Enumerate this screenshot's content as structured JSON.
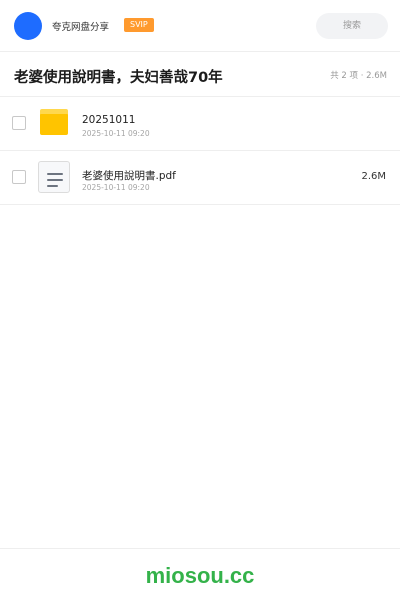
{
  "header": {
    "owner_name": "夸克网盘分享",
    "badge": "SVIP",
    "search_placeholder": "搜索"
  },
  "share": {
    "title": "老婆使用說明書，夫妇善哉70年",
    "summary": "共 2 项 · 2.6M"
  },
  "files": [
    {
      "name": "20251011",
      "date": "2025-10-11 09:20",
      "size": "",
      "icon": "folder-icon"
    },
    {
      "name": "老婆使用說明書.pdf",
      "date": "2025-10-11 09:20",
      "size": "2.6M",
      "icon": "document-icon"
    }
  ],
  "footer": {
    "site": "miosou.cc"
  },
  "colors": {
    "avatar": "#1e6cff",
    "badge": "#ff9a2e",
    "folder": "#ffc400",
    "footer_text": "#34b24a"
  }
}
